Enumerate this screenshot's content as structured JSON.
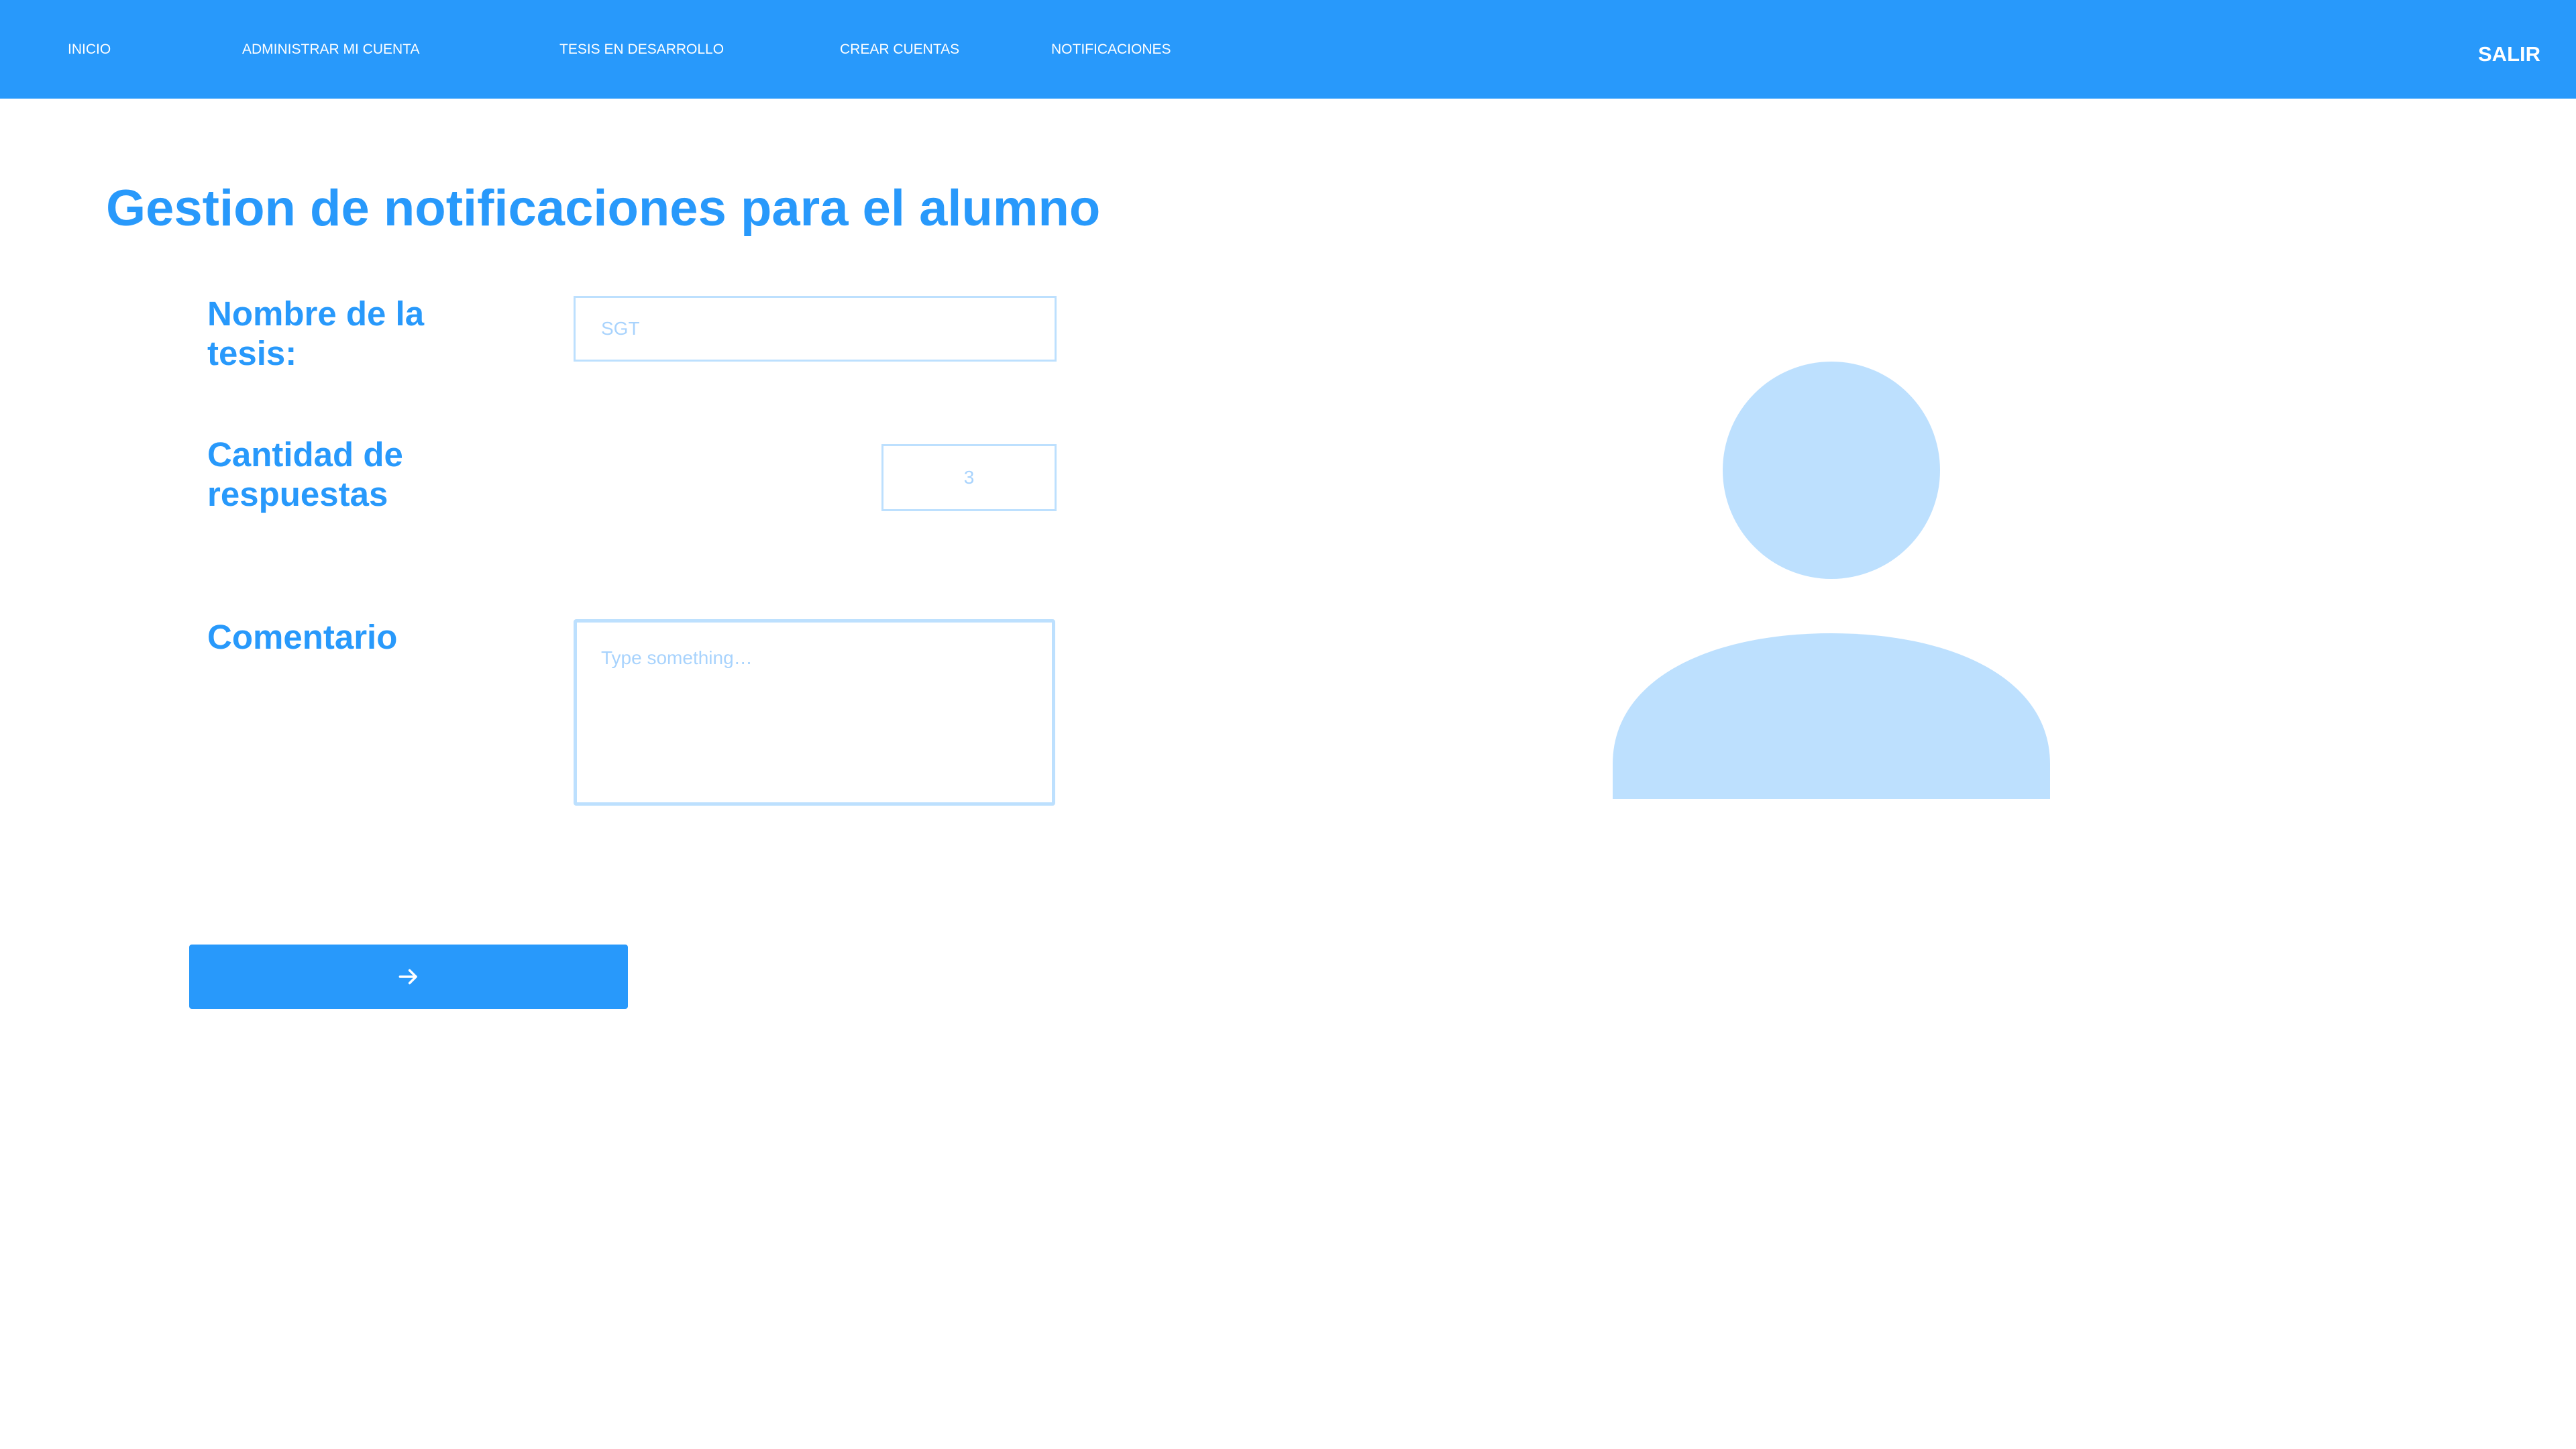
{
  "nav": {
    "items": [
      {
        "label": "INICIO"
      },
      {
        "label": "ADMINISTRAR MI CUENTA"
      },
      {
        "label": "TESIS EN DESARROLLO"
      },
      {
        "label": "CREAR CUENTAS"
      },
      {
        "label": "NOTIFICACIONES"
      }
    ],
    "logout_label": "SALIR"
  },
  "page": {
    "title": "Gestion de notificaciones para el alumno"
  },
  "form": {
    "tesis": {
      "label": "Nombre de la tesis:",
      "placeholder": "SGT"
    },
    "respuestas": {
      "label": "Cantidad de respuestas",
      "placeholder": "3"
    },
    "comentario": {
      "label": "Comentario",
      "placeholder": "Type something…"
    },
    "submit_icon": "arrow-right-icon"
  },
  "avatar": {
    "icon": "user-avatar-icon"
  },
  "colors": {
    "primary": "#2899fb",
    "light": "#bde0fe",
    "placeholder": "#a8d3fd"
  }
}
